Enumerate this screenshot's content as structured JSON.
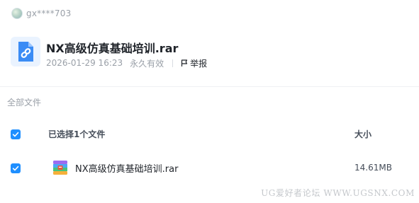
{
  "uploader": {
    "name": "gx****703"
  },
  "share": {
    "title": "NX高级仿真基础培训.rar",
    "date": "2026-01-29 16:23",
    "validity": "永久有效",
    "report_label": "举报"
  },
  "file_list": {
    "breadcrumb": "全部文件",
    "selected_label": "已选择1个文件",
    "size_header": "大小",
    "rows": [
      {
        "name": "NX高级仿真基础培训.rar",
        "size": "14.61MB",
        "checked": true
      }
    ]
  },
  "watermark": "UG爱好者论坛 WWW.UGSNX.COM",
  "colors": {
    "accent": "#1f8fff",
    "text_primary": "#1f2329",
    "text_secondary": "#9aa0a8"
  },
  "icons": {
    "share_file": "link-file-icon",
    "rar": "rar-archive-icon",
    "report": "flag-icon"
  }
}
